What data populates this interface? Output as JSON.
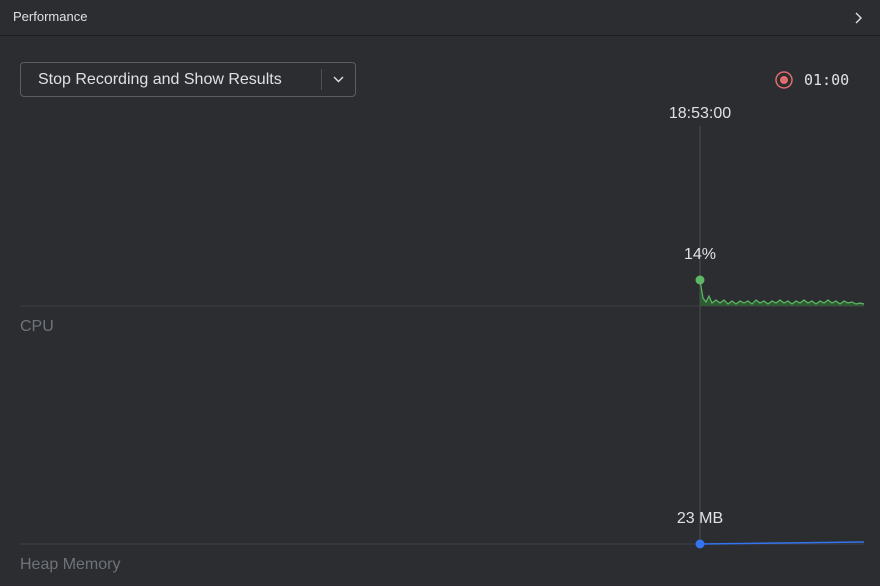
{
  "header": {
    "title": "Performance",
    "expand_icon": "chevron-right-icon"
  },
  "toolbar": {
    "stop_button_label": "Stop Recording and Show Results",
    "dropdown_icon": "chevron-down-icon"
  },
  "recording": {
    "indicator_icon": "record-icon",
    "indicator_color": "#e06c6c",
    "elapsed": "01:00"
  },
  "timeline": {
    "cursor_time": "18:53:00"
  },
  "cpu": {
    "label": "CPU",
    "current_value": "14%",
    "color": "#5fb865"
  },
  "memory": {
    "label": "Heap Memory",
    "current_value": "23 MB",
    "color": "#3574f0"
  }
}
